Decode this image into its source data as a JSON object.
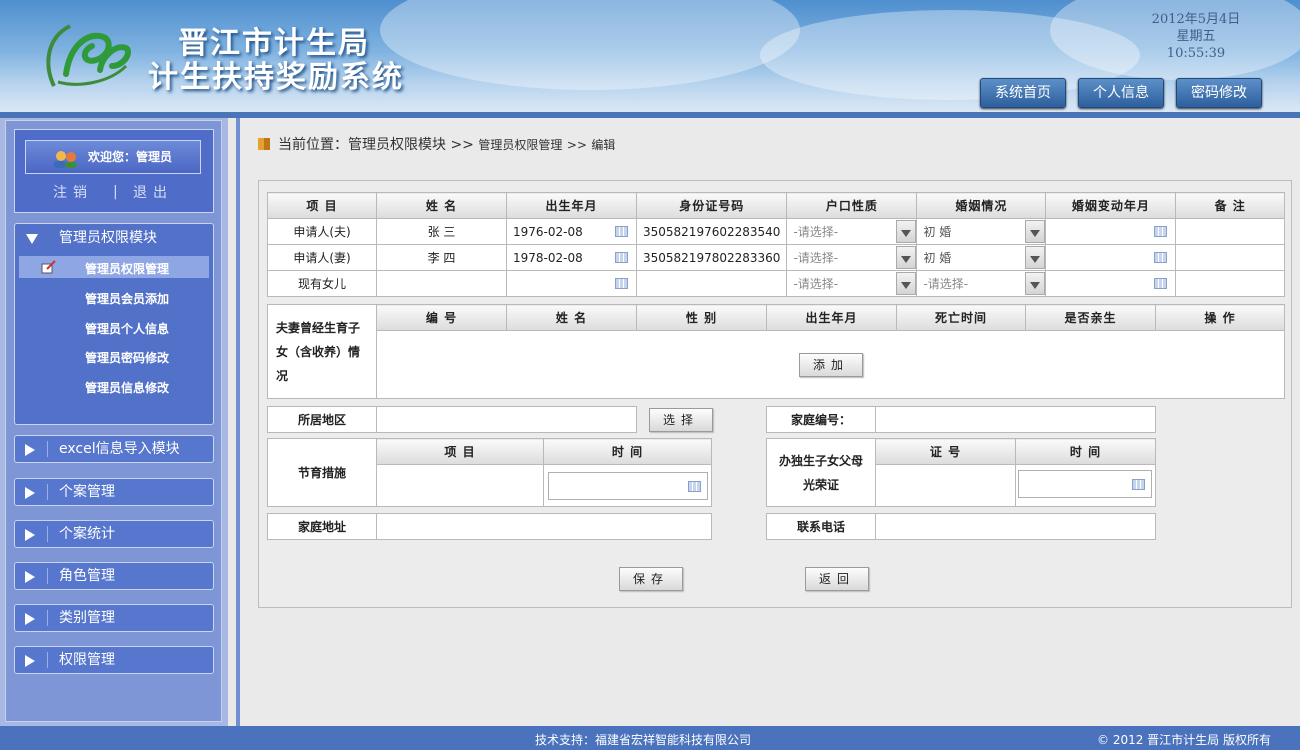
{
  "header": {
    "title1": "晋江市计生局",
    "title2": "计生扶持奖励系统",
    "date": "2012年5月4日",
    "weekday": "星期五",
    "time": "10:55:39",
    "nav": [
      "系统首页",
      "个人信息",
      "密码修改"
    ]
  },
  "sidebar": {
    "welcome": "欢迎您：管理员",
    "logout": "注销",
    "exit": "退出",
    "open_module": "管理员权限模块",
    "sub_items": [
      "管理员权限管理",
      "管理员会员添加",
      "管理员个人信息",
      "管理员密码修改",
      "管理员信息修改"
    ],
    "modules": [
      "excel信息导入模块",
      "个案管理",
      "个案统计",
      "角色管理",
      "类别管理",
      "权限管理"
    ]
  },
  "breadcrumb": {
    "prefix": "当前位置：",
    "level1": "管理员权限模块",
    "sep": ">>",
    "level2": "管理员权限管理",
    "level3": "编辑"
  },
  "form": {
    "headers": [
      "项 目",
      "姓 名",
      "出生年月",
      "身份证号码",
      "户口性质",
      "婚姻情况",
      "婚姻变动年月",
      "备 注"
    ],
    "rows": [
      {
        "item": "申请人(夫)",
        "name": "张 三",
        "birth": "1976-02-08",
        "id": "350582197602283540",
        "hukou": "-请选择-",
        "marriage": "初 婚"
      },
      {
        "item": "申请人(妻)",
        "name": "李 四",
        "birth": "1978-02-08",
        "id": "350582197802283360",
        "hukou": "-请选择-",
        "marriage": "初 婚"
      },
      {
        "item": "现有女儿",
        "name": "",
        "birth": "",
        "id": "",
        "hukou": "-请选择-",
        "marriage": "-请选择-"
      }
    ],
    "children_label": "夫妻曾经生育子女（含收养）情况",
    "children_headers": [
      "编 号",
      "姓 名",
      "性 别",
      "出生年月",
      "死亡时间",
      "是否亲生",
      "操 作"
    ],
    "add_btn": "添加",
    "region_label": "所居地区",
    "select_btn": "选择",
    "family_no_label": "家庭编号：",
    "birth_measure_label": "节育措施",
    "measure_headers": [
      "项 目",
      "时 间"
    ],
    "only_child_label": "办独生子女父母光荣证",
    "only_child_headers": [
      "证 号",
      "时 间"
    ],
    "address_label": "家庭地址",
    "phone_label": "联系电话",
    "save_btn": "保存",
    "back_btn": "返回"
  },
  "footer": {
    "support": "技术支持：福建省宏祥智能科技有限公司",
    "copyright": "© 2012 晋江市计生局 版权所有"
  },
  "colors": {
    "accent": "#4a72bd",
    "sidebar": "#7f96d6"
  }
}
